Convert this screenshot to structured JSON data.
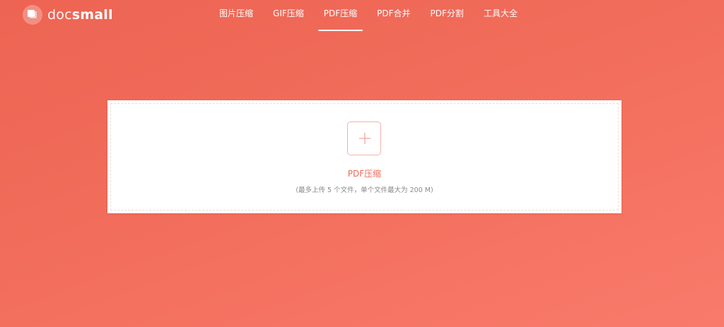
{
  "brand": {
    "name_part1": "doc",
    "name_part2": "small",
    "logo_icon": "chat-bubble-icon"
  },
  "nav": {
    "items": [
      {
        "label": "图片压缩"
      },
      {
        "label": "GIF压缩"
      },
      {
        "label": "PDF压缩",
        "active": true
      },
      {
        "label": "PDF合并"
      },
      {
        "label": "PDF分割"
      },
      {
        "label": "工具大全"
      }
    ]
  },
  "upload": {
    "icon": "plus-icon",
    "title": "PDF压缩",
    "hint": "(最多上传 5 个文件，单个文件最大为 200 M)"
  },
  "colors": {
    "background_start": "#ed6453",
    "background_end": "#f97a6b",
    "accent": "#ec6a58",
    "plus_border": "#f3b1a8",
    "hint_text": "#8a8a8a"
  }
}
